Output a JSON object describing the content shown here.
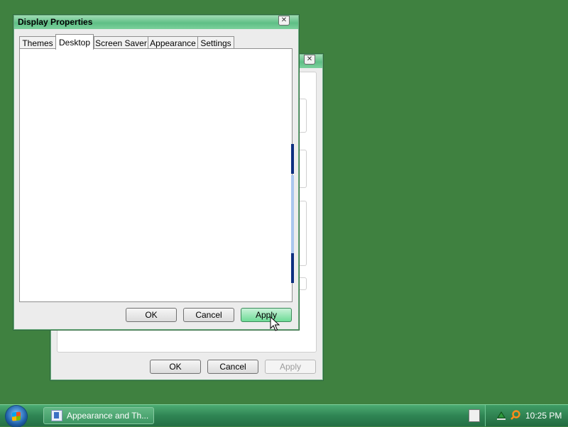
{
  "background_window": {
    "buttons": {
      "ok": "OK",
      "cancel": "Cancel",
      "apply": "Apply"
    }
  },
  "dialog": {
    "title": "Display Properties",
    "close_glyph": "✕",
    "tabs": [
      {
        "label": "Themes",
        "active": false
      },
      {
        "label": "Desktop",
        "active": true
      },
      {
        "label": "Screen Saver",
        "active": false
      },
      {
        "label": "Appearance",
        "active": false
      },
      {
        "label": "Settings",
        "active": false
      }
    ],
    "buttons": {
      "ok": "OK",
      "cancel": "Cancel",
      "apply": "Apply"
    }
  },
  "taskbar": {
    "window_button": "Appearance and Th...",
    "clock": "10:25 PM"
  },
  "colors": {
    "desktop": "#3f8140",
    "accent_green": "#6fdc97",
    "scroll_dark": "#0d2f80",
    "scroll_light": "#a9c6ee"
  },
  "icons": [
    "start-orb-icon",
    "control-panel-icon",
    "keyboard-icon",
    "network-icon",
    "search-icon",
    "close-icon",
    "mouse-cursor-icon"
  ]
}
